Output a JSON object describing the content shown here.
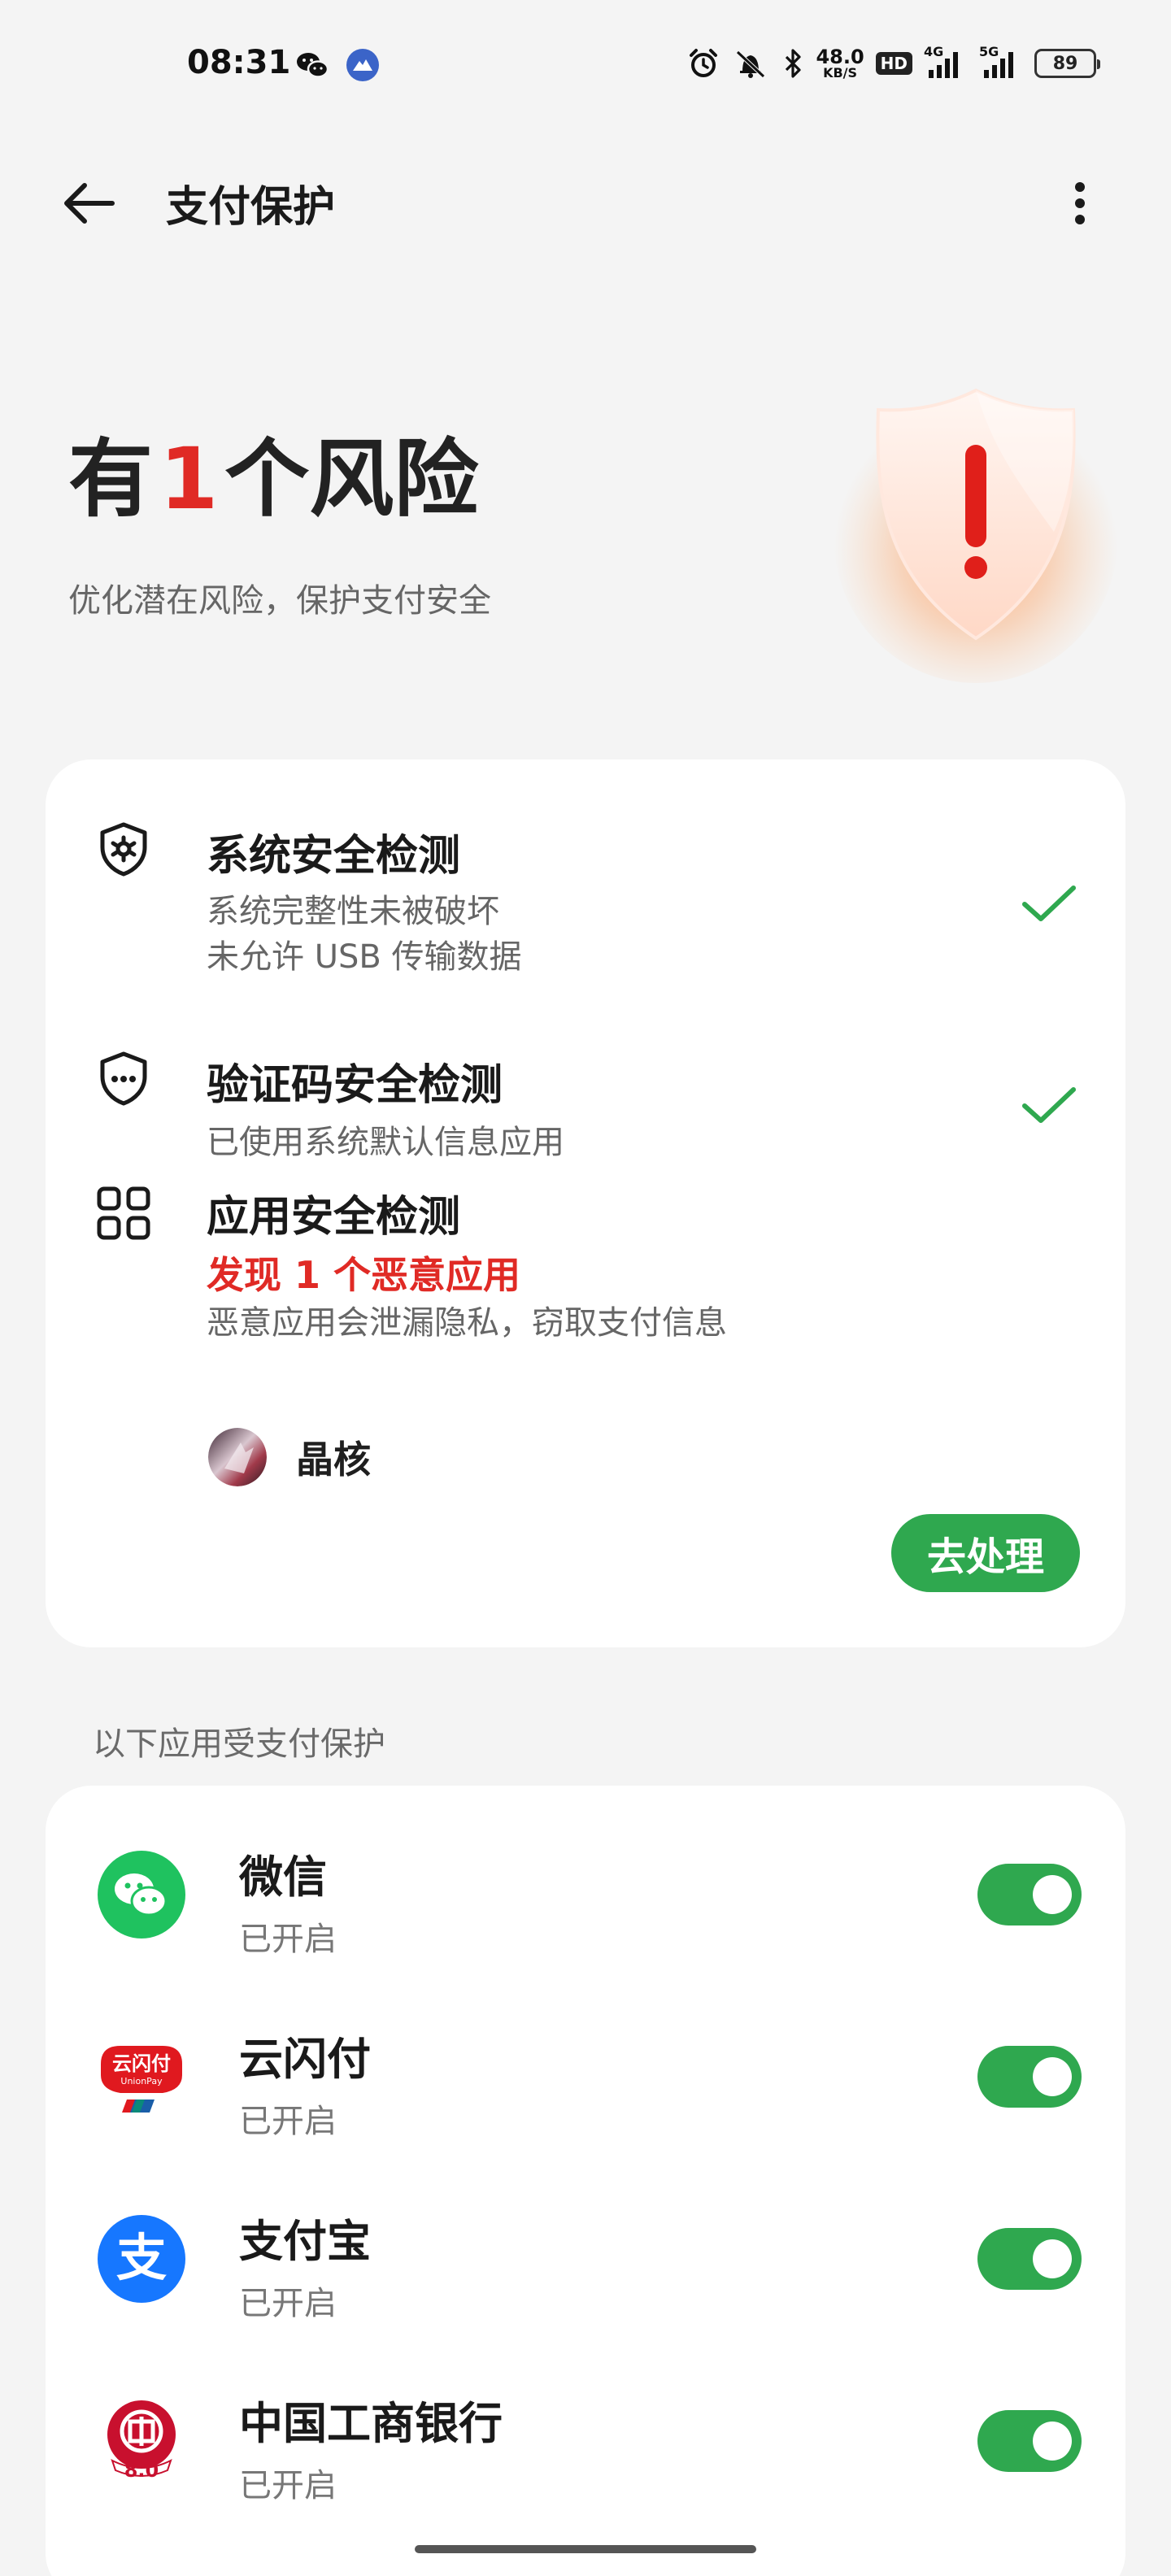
{
  "status_bar": {
    "time": "08:31",
    "network_speed_value": "48.0",
    "network_speed_unit": "KB/S",
    "hd_badge": "HD",
    "signal_1_label": "4G",
    "signal_2_label": "5G",
    "battery": "89",
    "icons": [
      "wechat-icon",
      "app-notification-icon",
      "alarm-icon",
      "mute-icon",
      "bluetooth-icon",
      "signal-icon"
    ]
  },
  "header": {
    "title": "支付保护",
    "back_icon": "arrow-left-icon",
    "more_icon": "more-vertical-icon"
  },
  "hero": {
    "title_prefix": "有",
    "risk_count": "1",
    "title_suffix": "个风险",
    "subtitle": "优化潜在风险，保护支付安全",
    "risk_color": "#e02a25"
  },
  "checks": {
    "system": {
      "title": "系统安全检测",
      "line1": "系统完整性未被破坏",
      "line2": "未允许 USB 传输数据",
      "status": "ok"
    },
    "sms": {
      "title": "验证码安全检测",
      "line1": "已使用系统默认信息应用",
      "status": "ok"
    },
    "apps": {
      "title": "应用安全检测",
      "warning": "发现 1 个恶意应用",
      "line1": "恶意应用会泄漏隐私，窃取支付信息",
      "malicious_app": "晶核",
      "action": "去处理",
      "status": "warning"
    }
  },
  "protected": {
    "section_label": "以下应用受支付保护",
    "apps": [
      {
        "name": "微信",
        "status": "已开启",
        "enabled": true
      },
      {
        "name": "云闪付",
        "status": "已开启",
        "enabled": true,
        "icon_text": "云闪付",
        "icon_subtext": "UnionPay"
      },
      {
        "name": "支付宝",
        "status": "已开启",
        "enabled": true,
        "icon_text": "支"
      },
      {
        "name": "中国工商银行",
        "status": "已开启",
        "enabled": true,
        "icon_text": "8.0"
      }
    ]
  },
  "colors": {
    "accent_green": "#2fa84f",
    "danger_red": "#e02a25",
    "background": "#f4f4f4"
  }
}
